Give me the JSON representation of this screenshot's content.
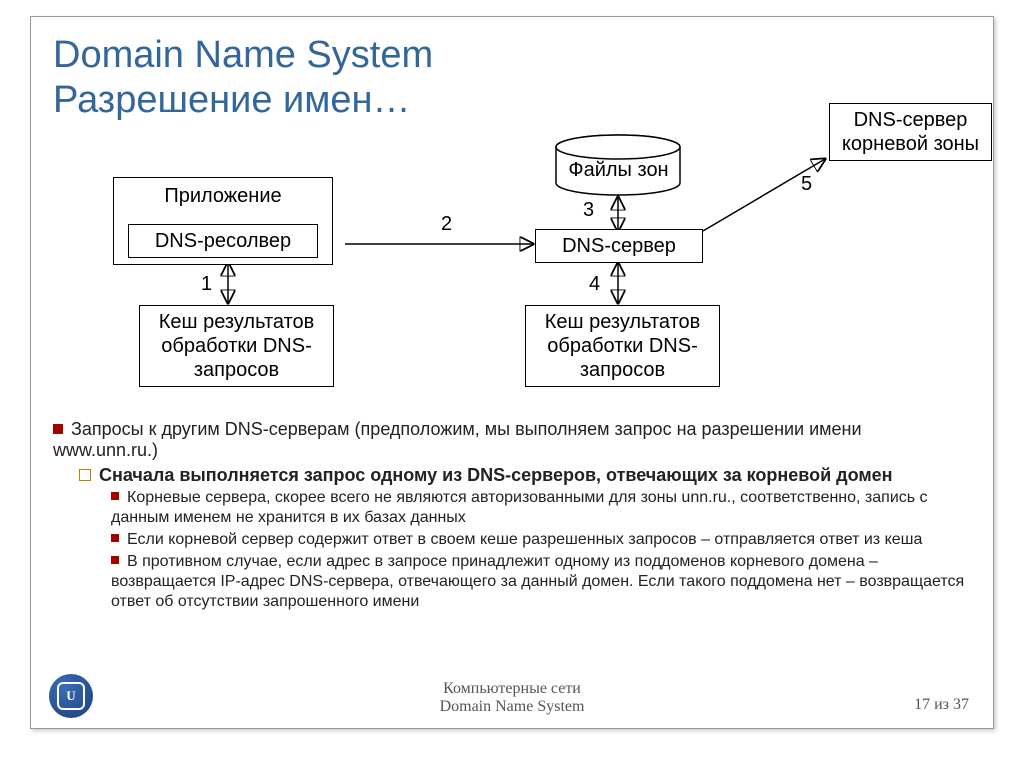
{
  "title_line1": "Domain Name System",
  "title_line2": "Разрешение имен…",
  "diagram": {
    "box_app": "Приложение",
    "box_resolver": "DNS-ресолвер",
    "box_cache_left": "Кеш результатов обработки DNS-запросов",
    "box_server": "DNS-сервер",
    "box_zone_files": "Файлы зон",
    "box_cache_right": "Кеш результатов обработки DNS-запросов",
    "box_root": "DNS-сервер корневой зоны",
    "n1": "1",
    "n2": "2",
    "n3": "3",
    "n4": "4",
    "n5": "5"
  },
  "bullets": {
    "l1": "Запросы к другим DNS-серверам (предположим, мы выполняем запрос на разрешении имени www.unn.ru.)",
    "l2": "Сначала выполняется запрос одному из DNS-серверов, отвечающих за корневой домен",
    "l3a": "Корневые сервера, скорее всего не являются авторизованными для зоны unn.ru., соответственно, запись с данным именем не хранится в их базах данных",
    "l3b": "Если корневой сервер содержит ответ в своем кеше разрешенных запросов – отправляется ответ из кеша",
    "l3c": "В противном случае, если адрес в запросе принадлежит одному из поддоменов корневого домена – возвращается IP-адрес DNS-сервера, отвечающего за данный домен. Если такого поддомена нет – возвращается ответ об отсутствии запрошенного имени"
  },
  "footer": {
    "line1": "Компьютерные сети",
    "line2": "Domain Name System",
    "page": "17 из 37"
  },
  "logo_text": "U"
}
